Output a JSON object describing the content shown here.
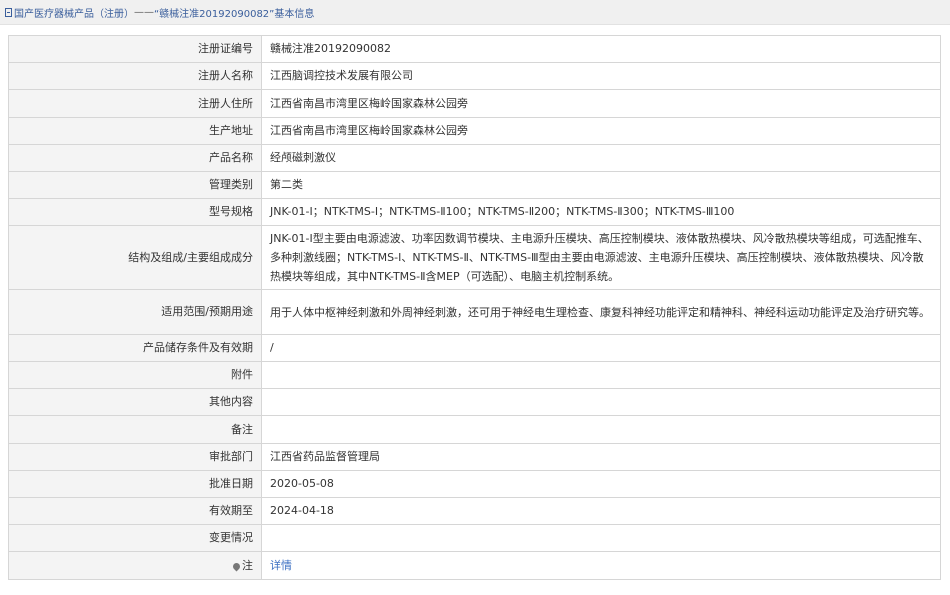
{
  "breadcrumb": {
    "category": "国产医疗器械产品（注册）",
    "separator": "——",
    "title": "“赣械注准20192090082”",
    "suffix": "基本信息"
  },
  "rows": [
    {
      "label": "注册证编号",
      "value": "赣械注准20192090082"
    },
    {
      "label": "注册人名称",
      "value": "江西脑调控技术发展有限公司"
    },
    {
      "label": "注册人住所",
      "value": "江西省南昌市湾里区梅岭国家森林公园旁"
    },
    {
      "label": "生产地址",
      "value": "江西省南昌市湾里区梅岭国家森林公园旁"
    },
    {
      "label": "产品名称",
      "value": "经颅磁刺激仪"
    },
    {
      "label": "管理类别",
      "value": "第二类"
    },
    {
      "label": "型号规格",
      "value": "JNK-01-Ⅰ；NTK-TMS-Ⅰ；NTK-TMS-Ⅱ100；NTK-TMS-Ⅱ200；NTK-TMS-Ⅱ300；NTK-TMS-Ⅲ100"
    },
    {
      "label": "结构及组成/主要组成成分",
      "value": "JNK-01-Ⅰ型主要由电源滤波、功率因数调节模块、主电源升压模块、高压控制模块、液体散热模块、风冷散热模块等组成，可选配推车、多种刺激线圈；NTK-TMS-Ⅰ、NTK-TMS-Ⅱ、NTK-TMS-Ⅲ型由主要由电源滤波、主电源升压模块、高压控制模块、液体散热模块、风冷散热模块等组成，其中NTK-TMS-Ⅱ含MEP（可选配）、电脑主机控制系统。"
    },
    {
      "label": "适用范围/预期用途",
      "value": "用于人体中枢神经刺激和外周神经刺激，还可用于神经电生理检查、康复科神经功能评定和精神科、神经科运动功能评定及治疗研究等。"
    },
    {
      "label": "产品储存条件及有效期",
      "value": "/"
    },
    {
      "label": "附件",
      "value": ""
    },
    {
      "label": "其他内容",
      "value": ""
    },
    {
      "label": "备注",
      "value": ""
    },
    {
      "label": "审批部门",
      "value": "江西省药品监督管理局"
    },
    {
      "label": "批准日期",
      "value": "2020-05-08"
    },
    {
      "label": "有效期至",
      "value": "2024-04-18"
    },
    {
      "label": "变更情况",
      "value": ""
    }
  ],
  "note": {
    "label": "注",
    "link": "详情"
  }
}
